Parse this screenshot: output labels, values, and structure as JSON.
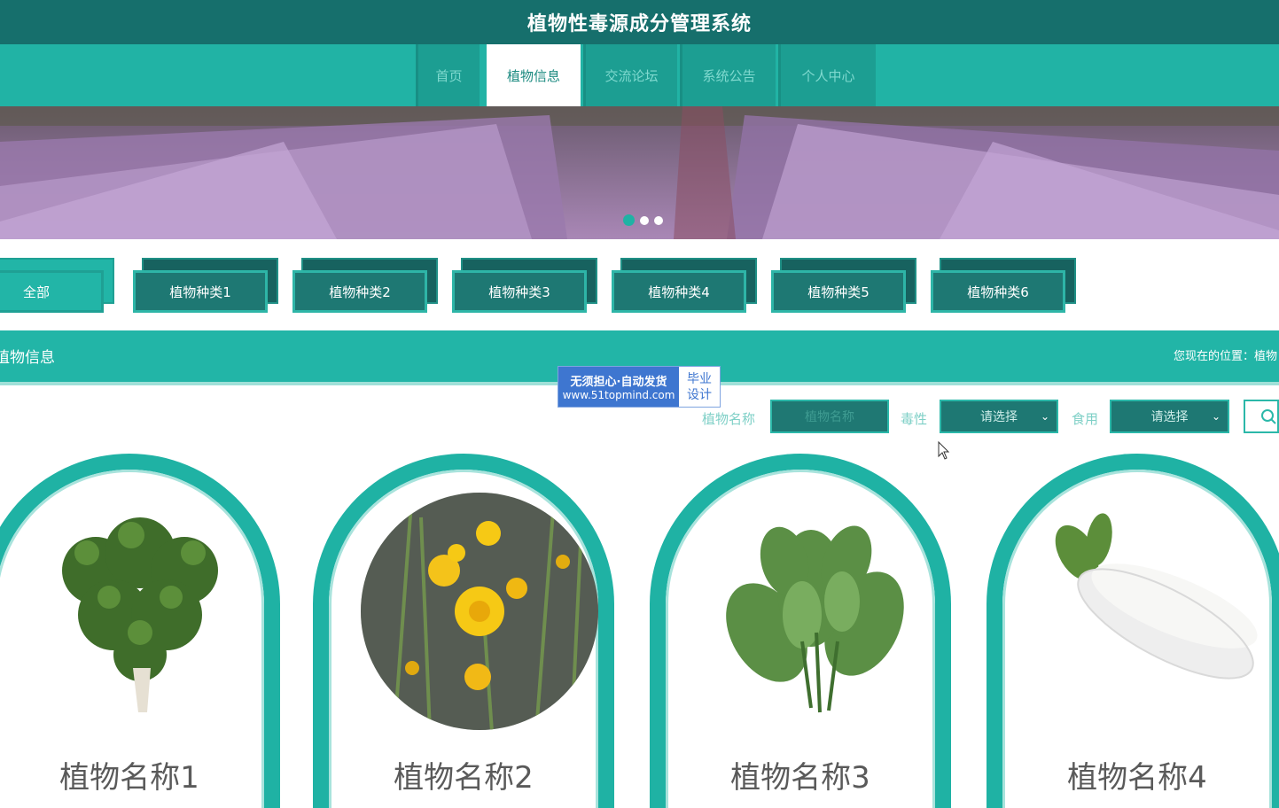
{
  "app": {
    "title": "植物性毒源成分管理系统"
  },
  "nav": {
    "items": [
      {
        "label": "首页"
      },
      {
        "label": "植物信息"
      },
      {
        "label": "交流论坛"
      },
      {
        "label": "系统公告"
      },
      {
        "label": "个人中心"
      }
    ],
    "active_index": 1
  },
  "banner": {
    "slides": 3,
    "active_slide": 0
  },
  "categories": [
    {
      "label": "全部"
    },
    {
      "label": "植物种类1"
    },
    {
      "label": "植物种类2"
    },
    {
      "label": "植物种类3"
    },
    {
      "label": "植物种类4"
    },
    {
      "label": "植物种类5"
    },
    {
      "label": "植物种类6"
    }
  ],
  "section": {
    "title": "植物信息",
    "breadcrumb": "您现在的位置：植物"
  },
  "watermark": {
    "line1": "无须担心·自动发货",
    "line2": "www.51topmind.com",
    "right_line1": "毕业",
    "right_line2": "设计"
  },
  "search": {
    "name_label": "植物名称",
    "name_placeholder": "植物名称",
    "toxicity_label": "毒性",
    "toxicity_value": "请选择",
    "edible_label": "食用",
    "edible_value": "请选择",
    "button_icon": "search-icon"
  },
  "cards": [
    {
      "name": "植物名称1",
      "image": "coriander"
    },
    {
      "name": "植物名称2",
      "image": "yellow-flowers"
    },
    {
      "name": "植物名称3",
      "image": "leafy-greens"
    },
    {
      "name": "植物名称4",
      "image": "white-radish"
    }
  ],
  "colors": {
    "header_dark": "#166f6c",
    "teal": "#21b3a5",
    "nav_item": "#1c9e92"
  }
}
